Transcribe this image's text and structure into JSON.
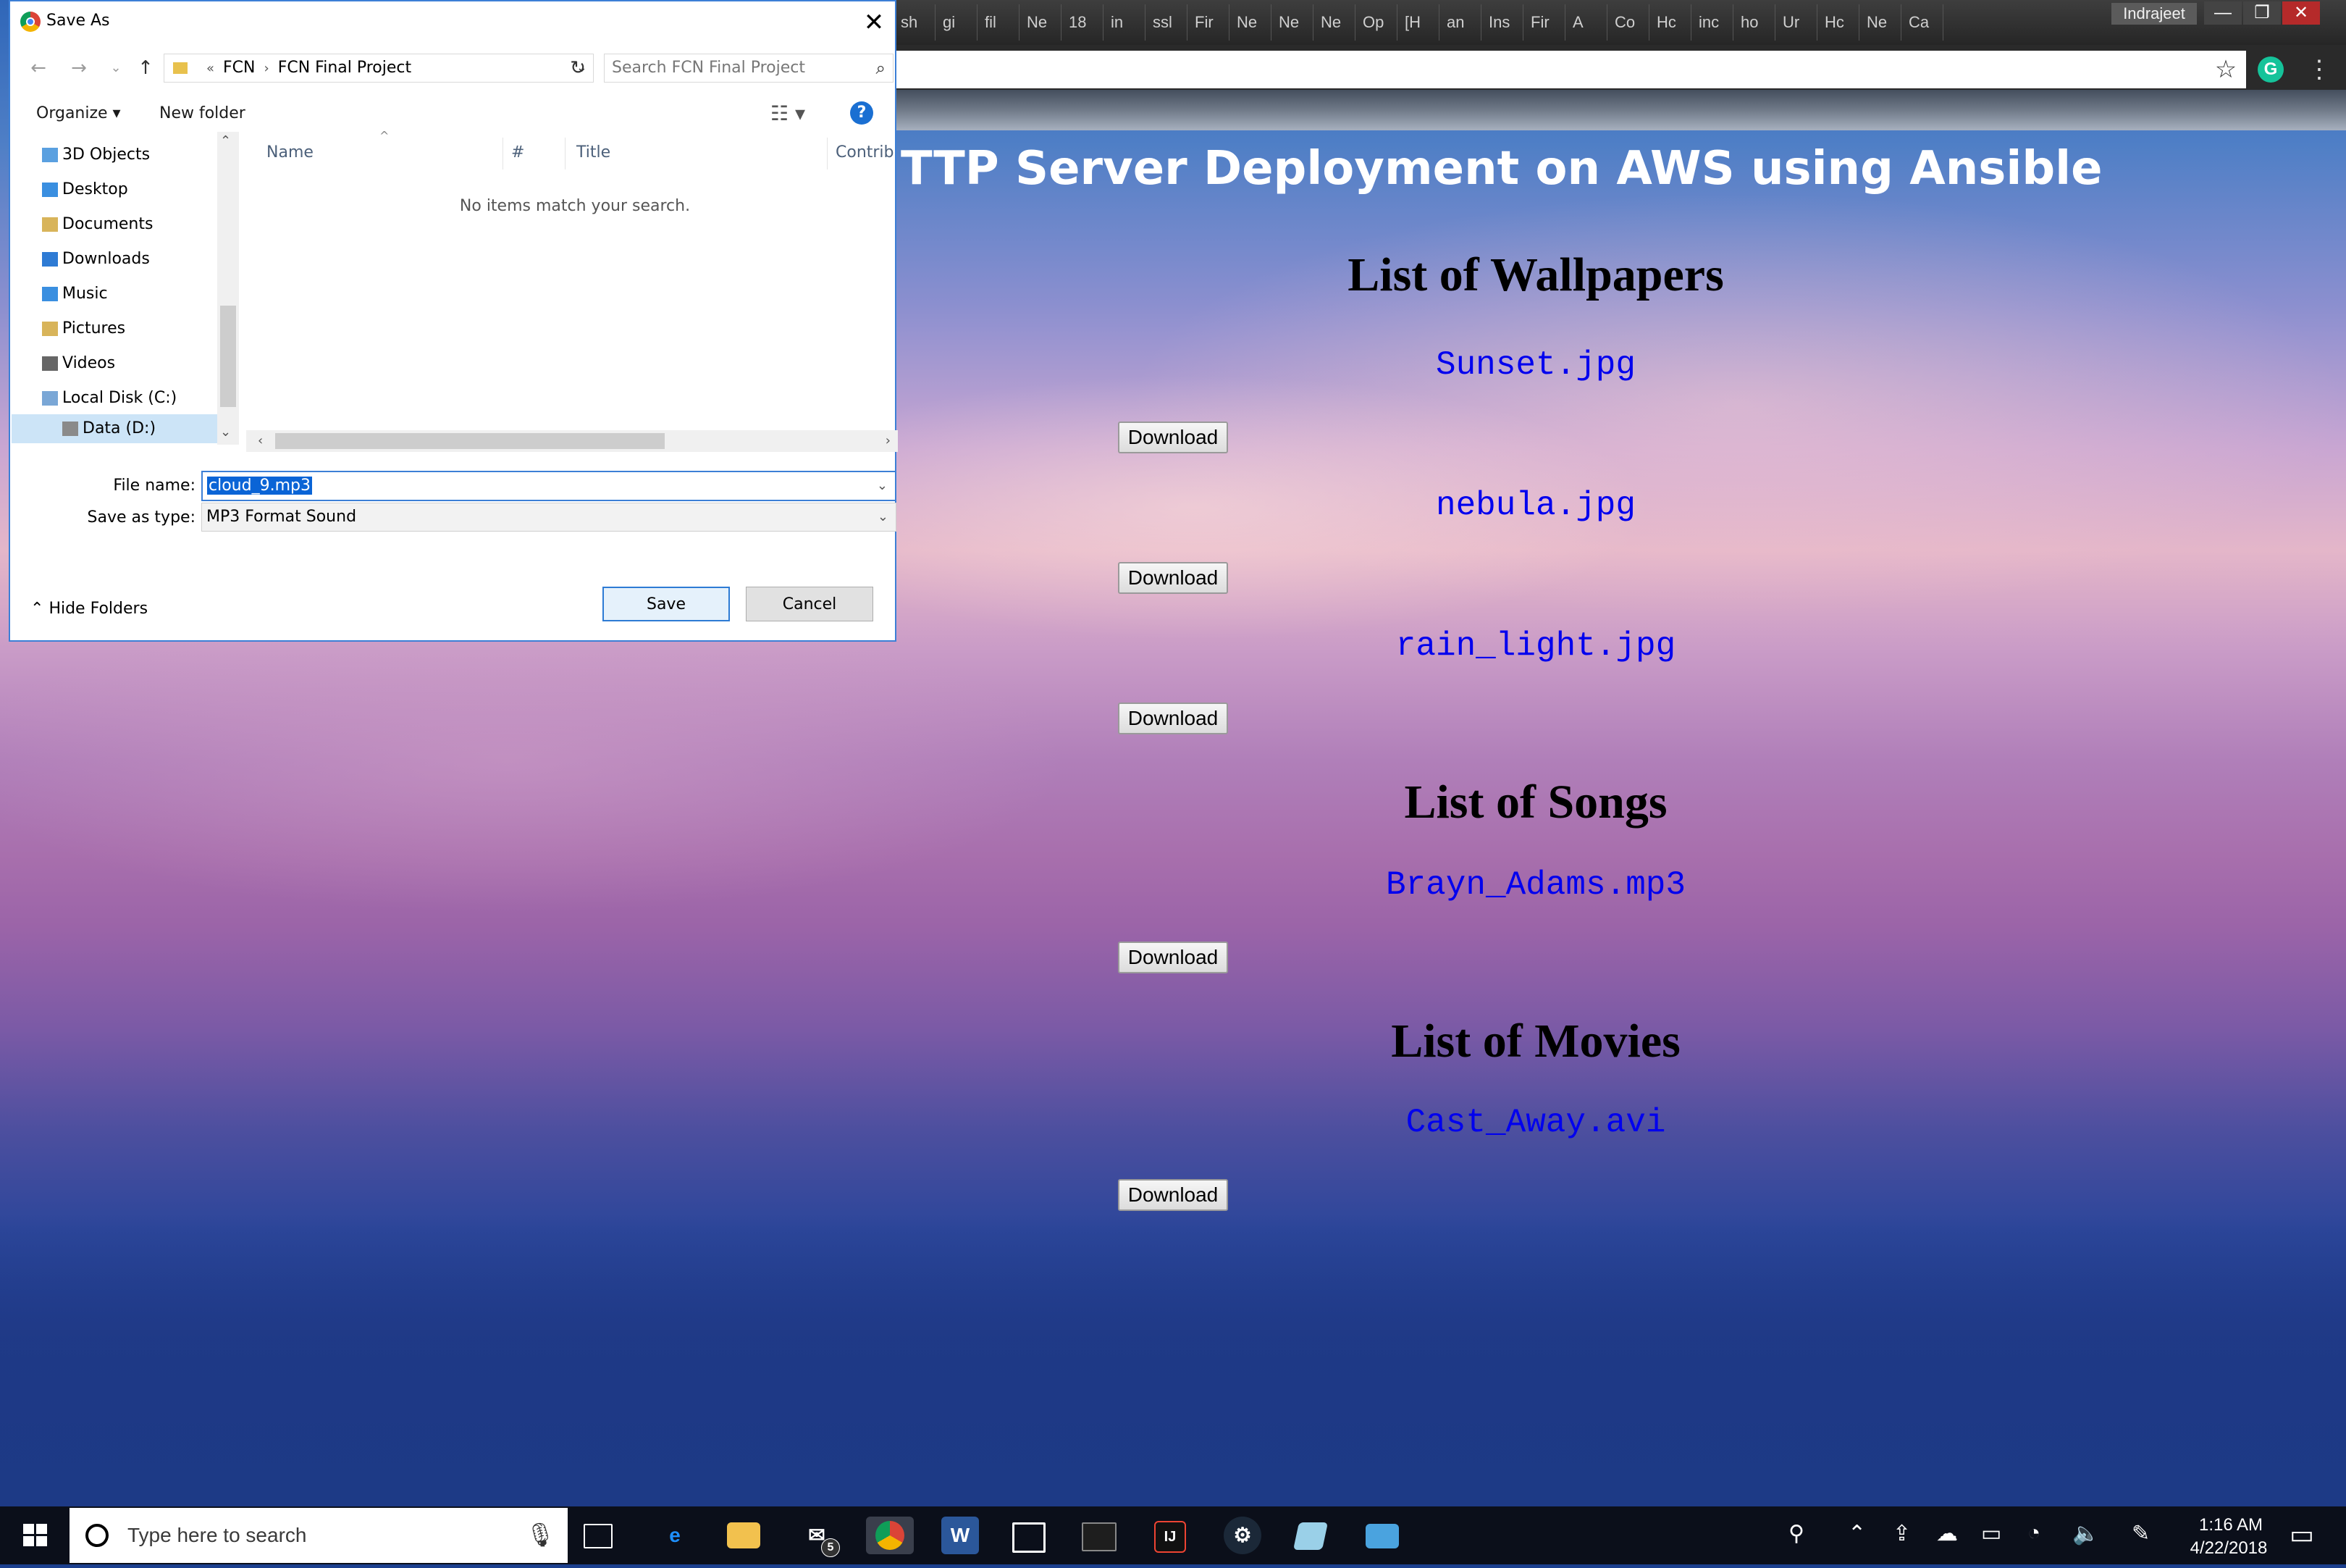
{
  "browser": {
    "profile_name": "Indrajeet",
    "tabs": [
      "sh",
      "gi",
      "fil",
      "Ne",
      "18",
      "in",
      "ssl",
      "Fir",
      "Ne",
      "Ne",
      "Ne",
      "Op",
      "[H",
      "an",
      "Ins",
      "Fir",
      "A",
      "Co",
      "Hc",
      "inc",
      "ho",
      "Ur",
      "Hc",
      "Ne",
      "Ca"
    ],
    "minimize": "—",
    "restore": "❐",
    "close": "✕"
  },
  "page": {
    "heading": "TTP Server Deployment on AWS using Ansible",
    "sections": [
      {
        "title": "List of Wallpapers",
        "items": [
          {
            "name": "Sunset.jpg",
            "button": "Download"
          },
          {
            "name": "nebula.jpg",
            "button": "Download"
          },
          {
            "name": "rain_light.jpg",
            "button": "Download"
          }
        ]
      },
      {
        "title": "List of Songs",
        "items": [
          {
            "name": "Brayn_Adams.mp3",
            "button": "Download"
          }
        ]
      },
      {
        "title": "List of Movies",
        "items": [
          {
            "name": "Cast_Away.avi",
            "button": "Download"
          }
        ]
      }
    ]
  },
  "dialog": {
    "title": "Save As",
    "breadcrumb": [
      "FCN",
      "FCN Final Project"
    ],
    "breadcrumb_overflow": "«",
    "search_placeholder": "Search FCN Final Project",
    "toolbar": {
      "organize": "Organize ▾",
      "new_folder": "New folder"
    },
    "nav_items": [
      {
        "label": "3D Objects",
        "icon": "3d-objects-icon",
        "color": "#5aa0e0"
      },
      {
        "label": "Desktop",
        "icon": "desktop-icon",
        "color": "#3a8fe0"
      },
      {
        "label": "Documents",
        "icon": "documents-icon",
        "color": "#d8b45a"
      },
      {
        "label": "Downloads",
        "icon": "downloads-icon",
        "color": "#2e7bd4"
      },
      {
        "label": "Music",
        "icon": "music-icon",
        "color": "#3a8fe0"
      },
      {
        "label": "Pictures",
        "icon": "pictures-icon",
        "color": "#d8b45a"
      },
      {
        "label": "Videos",
        "icon": "videos-icon",
        "color": "#666666"
      },
      {
        "label": "Local Disk (C:)",
        "icon": "local-disk-icon",
        "color": "#7aa7d6"
      },
      {
        "label": "Data (D:)",
        "icon": "data-drive-icon",
        "color": "#8a8a8a"
      }
    ],
    "columns": [
      "Name",
      "#",
      "Title",
      "Contributing"
    ],
    "empty_message": "No items match your search.",
    "file_name_label": "File name:",
    "file_name_value": "cloud_9.mp3",
    "save_type_label": "Save as type:",
    "save_type_value": "MP3 Format Sound",
    "hide_folders": "Hide Folders",
    "save_button": "Save",
    "cancel_button": "Cancel"
  },
  "taskbar": {
    "search_placeholder": "Type here to search",
    "mail_badge": "5",
    "time": "1:16 AM",
    "date": "4/22/2018"
  }
}
